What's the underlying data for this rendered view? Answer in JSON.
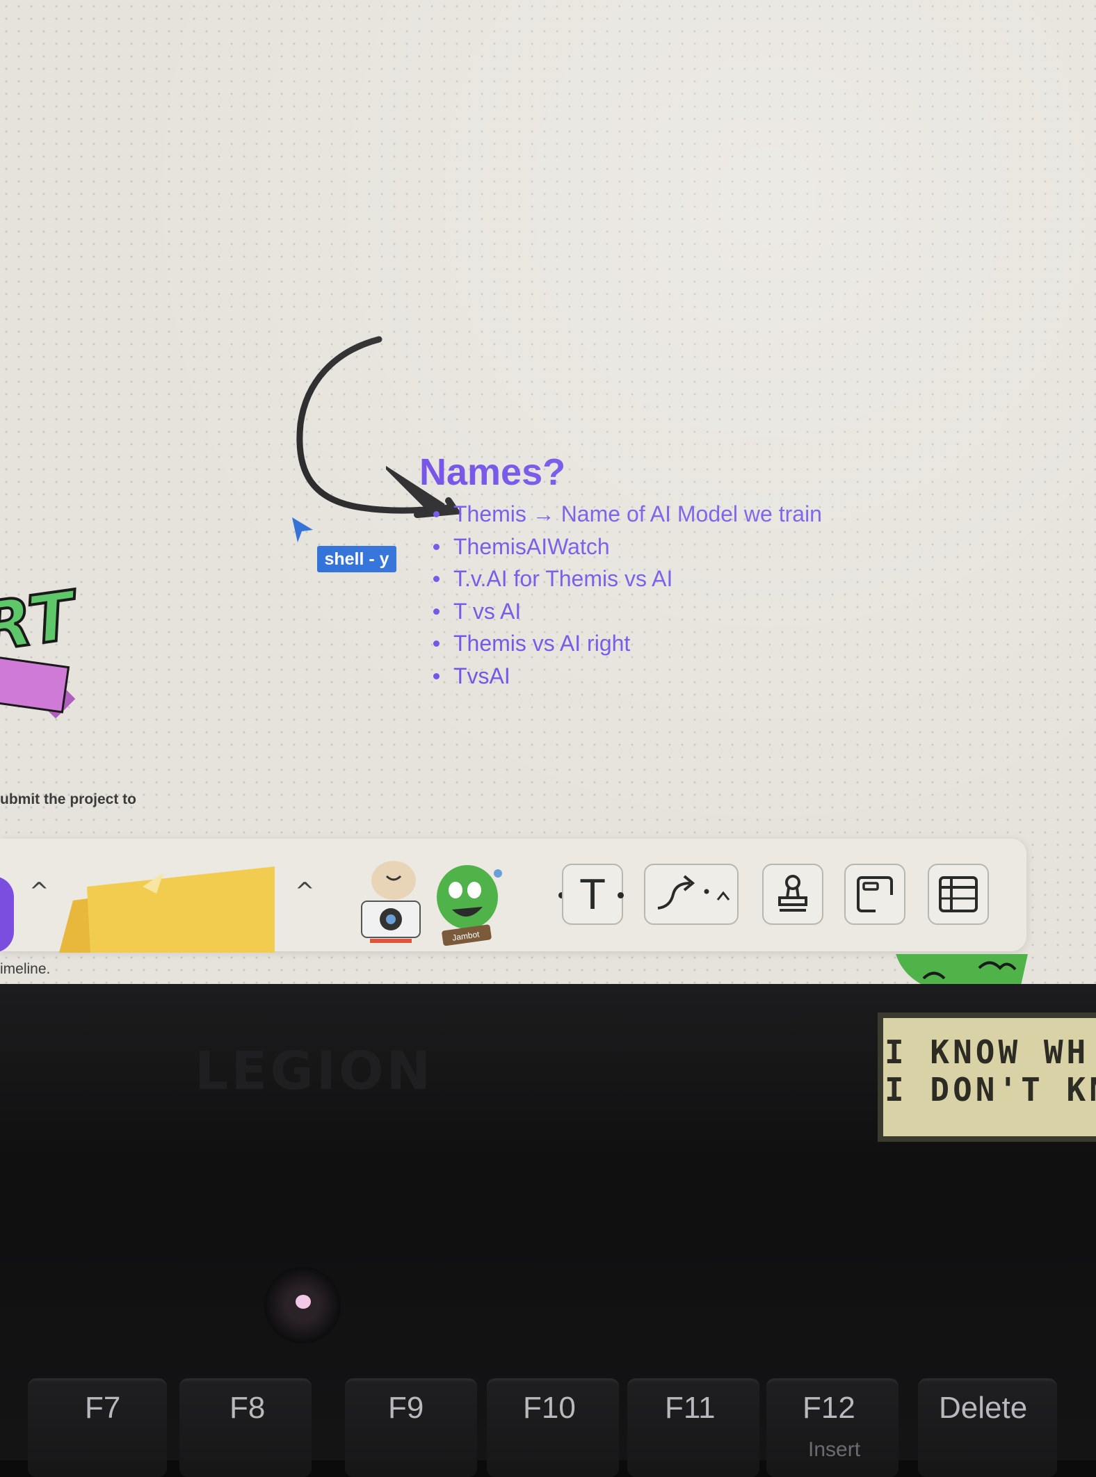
{
  "note": {
    "title": "Names?",
    "items": [
      "Themis → Name of AI Model we train",
      "ThemisAIWatch",
      "T.v.AI for Themis vs AI",
      "T vs AI",
      "Themis vs AI right",
      "TvsAI"
    ]
  },
  "collaborator": {
    "tag": "shell - y"
  },
  "canvas_snippets": {
    "submit_text": "ubmit the project to",
    "timeline_text": "imeline."
  },
  "toolbar": {
    "text_tool_label": "T",
    "sticker_label": "Jambot",
    "icons": [
      "chevron-up-icon",
      "sticky-note-icon",
      "camera-sticker-icon",
      "jambot-sticker-icon",
      "text-icon",
      "connector-icon",
      "stamp-icon",
      "frame-icon",
      "table-icon"
    ]
  },
  "laptop": {
    "brand": "LEGION",
    "sign_lines": [
      "I KNOW WH",
      "I DON'T KN"
    ],
    "keys": [
      "F7",
      "F8",
      "F9",
      "F10",
      "F11",
      "F12",
      "Delete"
    ],
    "key_sub": "Insert"
  },
  "colors": {
    "accent": "#6b47e6",
    "tag_blue": "#2d6fd8",
    "sticky_yellow": "#f2cc4e"
  }
}
